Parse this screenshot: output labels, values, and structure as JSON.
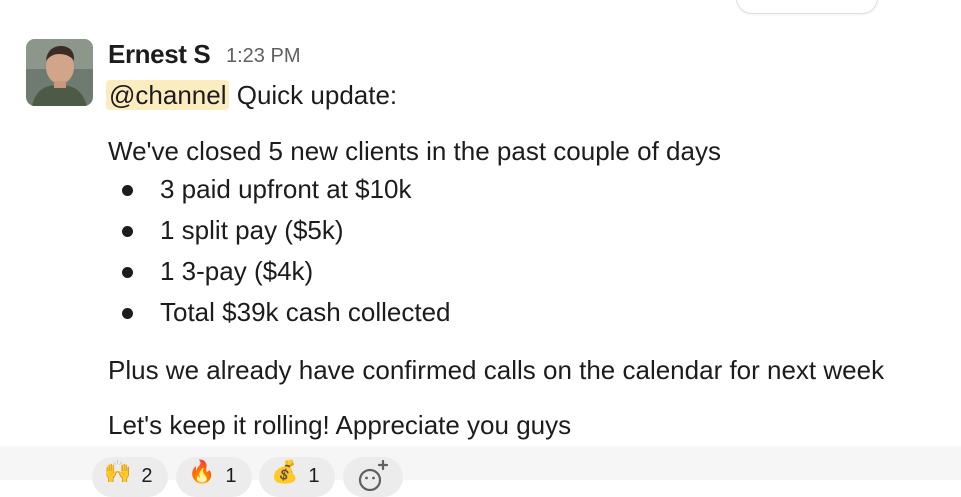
{
  "message": {
    "author": "Ernest S",
    "time": "1:23 PM",
    "mention": "@channel",
    "intro": "Quick update:",
    "paragraph1": "We've closed 5 new clients in the past couple of days",
    "bullets": [
      "3 paid upfront at $10k",
      "1 split pay ($5k)",
      "1 3-pay ($4k)",
      "Total $39k cash collected"
    ],
    "paragraph2": "Plus we already have confirmed calls on the calendar for next week",
    "paragraph3": "Let's keep it rolling! Appreciate you guys"
  },
  "reactions": [
    {
      "icon": "raised-hands-icon",
      "glyph": "🙌",
      "count": "2"
    },
    {
      "icon": "fire-icon",
      "glyph": "🔥",
      "count": "1"
    },
    {
      "icon": "money-bag-icon",
      "glyph": "💰",
      "count": "1"
    }
  ],
  "colors": {
    "mention_bg": "#fcedc1",
    "text": "#1d1c1d",
    "muted": "#616061"
  }
}
